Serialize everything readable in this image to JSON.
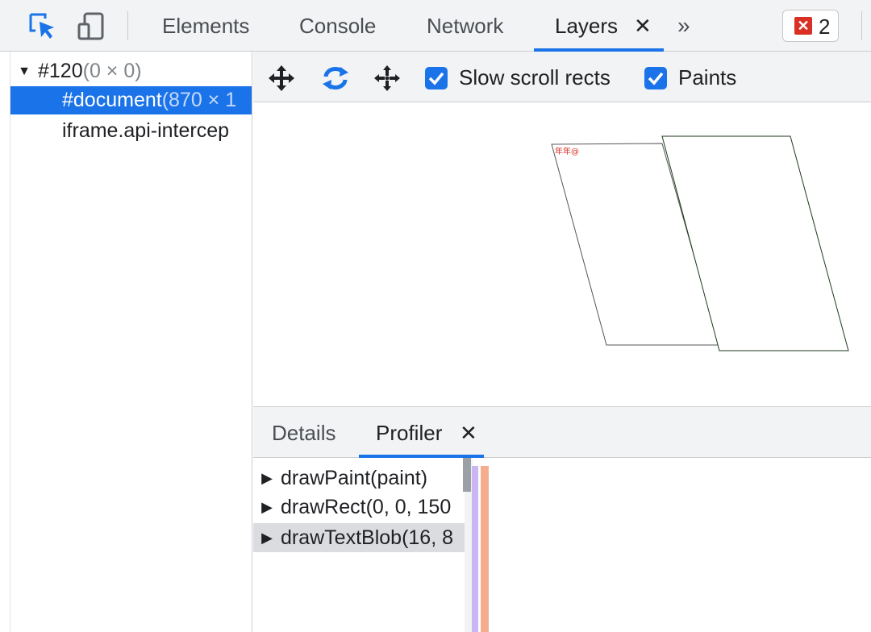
{
  "toolbar": {
    "icons": [
      "inspect-element-icon",
      "device-toolbar-icon"
    ],
    "tabs": [
      {
        "label": "Elements"
      },
      {
        "label": "Console"
      },
      {
        "label": "Network"
      },
      {
        "label": "Layers",
        "active": true,
        "closable": true
      }
    ],
    "close_glyph": "✕",
    "overflow_glyph": "»",
    "error_count": "2",
    "accent": "#1a73e8",
    "error_color": "#d93025"
  },
  "tree": {
    "rows": [
      {
        "name": "#120",
        "dim": "(0 × 0)",
        "expanded": true
      },
      {
        "name": "#document",
        "dim": "(870 × 1",
        "selected": true
      },
      {
        "name": "iframe.api-intercep",
        "dim": ""
      }
    ]
  },
  "layers_toolbar": {
    "icons": [
      "pan-mode-icon",
      "rotate-mode-icon",
      "reset-transform-icon"
    ],
    "checkboxes": [
      {
        "label": "Slow scroll rects",
        "checked": true
      },
      {
        "label": "Paints",
        "checked": true
      }
    ]
  },
  "canvas": {
    "layer_text": "年年@"
  },
  "bottom": {
    "tabs": [
      {
        "label": "Details"
      },
      {
        "label": "Profiler",
        "active": true,
        "closable": true
      }
    ],
    "commands": [
      {
        "label": "drawPaint(paint)"
      },
      {
        "label": "drawRect(0, 0, 150"
      },
      {
        "label": "drawTextBlob(16, 8",
        "highlighted": true
      }
    ]
  }
}
